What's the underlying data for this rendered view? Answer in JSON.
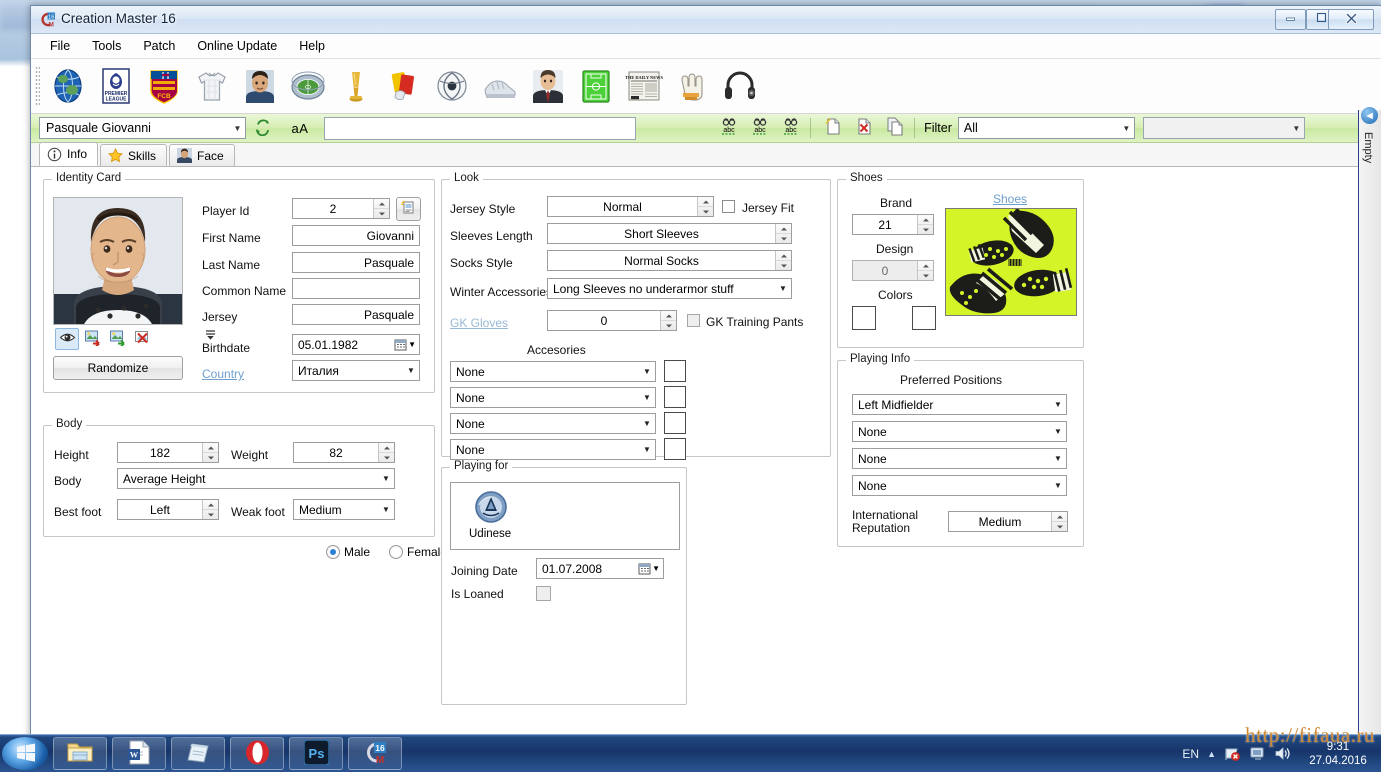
{
  "window": {
    "title": "Creation Master 16",
    "minimize_label": "–",
    "maximize_label": "❐",
    "close_label": "✕"
  },
  "menu": [
    {
      "label": "File"
    },
    {
      "label": "Tools"
    },
    {
      "label": "Patch"
    },
    {
      "label": "Online Update"
    },
    {
      "label": "Help"
    }
  ],
  "toolbar_icons": [
    {
      "name": "globe-icon"
    },
    {
      "name": "premier-league-badge-icon"
    },
    {
      "name": "barcelona-crest-icon"
    },
    {
      "name": "jersey-kit-icon"
    },
    {
      "name": "player-face-icon"
    },
    {
      "name": "stadium-icon"
    },
    {
      "name": "trophy-icon"
    },
    {
      "name": "referee-cards-icon"
    },
    {
      "name": "football-ball-icon"
    },
    {
      "name": "boots-icon"
    },
    {
      "name": "manager-icon"
    },
    {
      "name": "pitch-tactics-icon"
    },
    {
      "name": "newspaper-icon"
    },
    {
      "name": "goalkeeper-gloves-icon"
    },
    {
      "name": "headphones-icon"
    }
  ],
  "searchbar": {
    "player_value": "Pasquale Giovanni",
    "refresh_icon": "refresh-arrows-icon",
    "case_button_label": "aА",
    "find_buttons": [
      "find-abc-icon",
      "find-abc-2-icon",
      "find-abc-3-icon"
    ],
    "doc_buttons": [
      "new-document-icon",
      "delete-document-icon",
      "copy-document-icon"
    ],
    "filter_label": "Filter",
    "filter_value": "All",
    "filter_secondary_value": ""
  },
  "tabs": [
    {
      "label": "Info",
      "icon": "info-circle-icon",
      "active": true
    },
    {
      "label": "Skills",
      "icon": "star-icon",
      "active": false
    },
    {
      "label": "Face",
      "icon": "face-photo-icon",
      "active": false
    }
  ],
  "identity_card": {
    "title": "Identity Card",
    "photo_alt": "player-portrait",
    "photo_tools": [
      {
        "name": "preview-eye-icon",
        "selected": true
      },
      {
        "name": "import-image-icon",
        "selected": false
      },
      {
        "name": "export-image-icon",
        "selected": false
      },
      {
        "name": "delete-image-icon",
        "selected": false
      }
    ],
    "photo_more_label": "▾",
    "randomize_label": "Randomize",
    "fields": {
      "player_id_label": "Player Id",
      "player_id_value": "2",
      "first_name_label": "First Name",
      "first_name_value": "Giovanni",
      "last_name_label": "Last Name",
      "last_name_value": "Pasquale",
      "common_name_label": "Common Name",
      "common_name_value": "",
      "jersey_label": "Jersey",
      "jersey_value": "Pasquale",
      "birthdate_label": "Birthdate",
      "birthdate_value": "05.01.1982",
      "country_label": "Country",
      "country_value": "Италия"
    },
    "gender": {
      "male_label": "Male",
      "female_label": "Female",
      "selected": "Male"
    },
    "id_picker_icon": "id-card-picker-icon",
    "calendar_icon": "calendar-icon"
  },
  "body": {
    "title": "Body",
    "height_label": "Height",
    "height_value": "182",
    "weight_label": "Weight",
    "weight_value": "82",
    "body_label": "Body",
    "body_value": "Average Height",
    "best_foot_label": "Best foot",
    "best_foot_value": "Left",
    "weak_foot_label": "Weak foot",
    "weak_foot_value": "Medium"
  },
  "look": {
    "title": "Look",
    "jersey_style_label": "Jersey Style",
    "jersey_style_value": "Normal",
    "jersey_fit_label": "Jersey Fit",
    "jersey_fit_checked": false,
    "sleeves_length_label": "Sleeves Length",
    "sleeves_length_value": "Short Sleeves",
    "socks_style_label": "Socks Style",
    "socks_style_value": "Normal Socks",
    "winter_accessories_label": "Winter Accessories",
    "winter_accessories_value": "Long Sleeves no underarmor stuff",
    "gk_gloves_label": "GK Gloves",
    "gk_gloves_value": "0",
    "gk_training_pants_label": "GK Training Pants",
    "gk_training_pants_checked": false,
    "accessories_label": "Accesories",
    "accessories": [
      {
        "value": "None"
      },
      {
        "value": "None"
      },
      {
        "value": "None"
      },
      {
        "value": "None"
      }
    ]
  },
  "playing_for": {
    "title": "Playing for",
    "club_name": "Udinese",
    "club_badge_icon": "udinese-badge-icon",
    "joining_date_label": "Joining Date",
    "joining_date_value": "01.07.2008",
    "is_loaned_label": "Is Loaned",
    "is_loaned_checked": false,
    "calendar_icon": "calendar-icon"
  },
  "shoes": {
    "title": "Shoes",
    "brand_label": "Brand",
    "brand_value": "21",
    "shoes_link_label": "Shoes",
    "design_label": "Design",
    "design_value": "0",
    "colors_label": "Colors",
    "color_1": "#ffffff",
    "color_2": "#ffffff",
    "preview_bg": "#d4f428"
  },
  "playing_info": {
    "title": "Playing Info",
    "preferred_positions_label": "Preferred Positions",
    "positions": [
      {
        "value": "Left Midfielder"
      },
      {
        "value": "None"
      },
      {
        "value": "None"
      },
      {
        "value": "None"
      }
    ],
    "international_reputation_label": "International\nReputation",
    "international_reputation_line1": "International",
    "international_reputation_line2": "Reputation",
    "international_reputation_value": "Medium"
  },
  "rail": {
    "label": "Empty",
    "collapse_icon": "back-circle-icon"
  },
  "taskbar": {
    "start_icon": "windows-start-orb",
    "buttons": [
      {
        "name": "explorer-icon"
      },
      {
        "name": "word-icon"
      },
      {
        "name": "notepad-icon"
      },
      {
        "name": "opera-icon"
      },
      {
        "name": "photoshop-icon"
      },
      {
        "name": "creation-master-icon"
      }
    ],
    "tray_language": "EN",
    "tray_show_hidden": "▲",
    "tray_icons": [
      "network-error-icon",
      "display-icon",
      "volume-icon"
    ],
    "clock_time": "9:31",
    "clock_date": "27.04.2016"
  },
  "watermark": {
    "text": "http://fifaua.ru"
  }
}
